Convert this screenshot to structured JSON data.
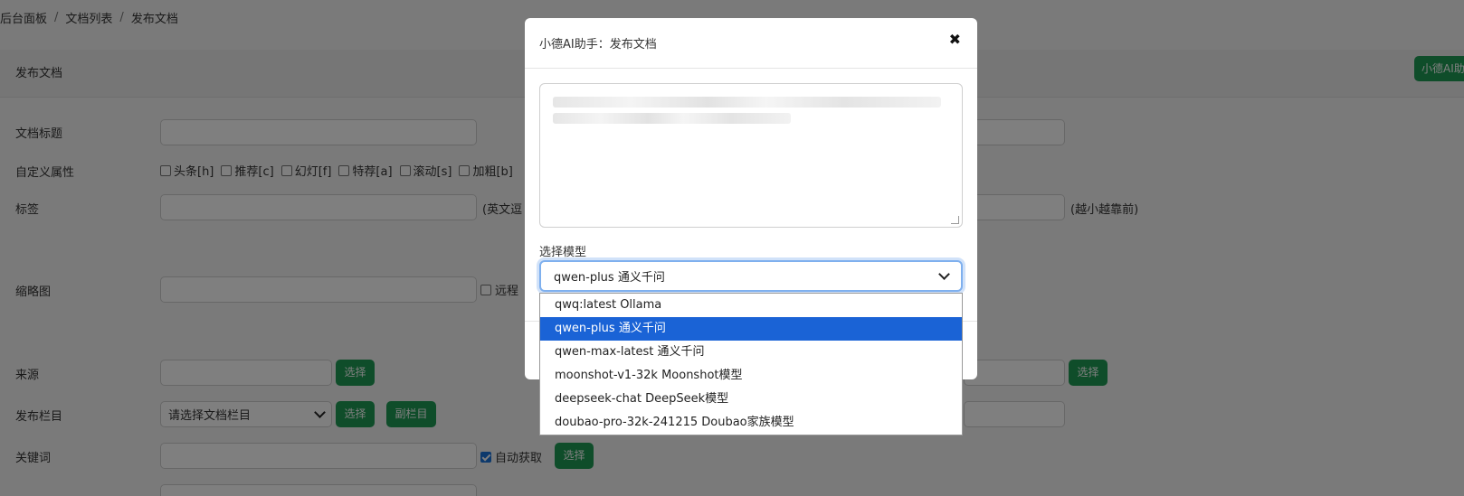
{
  "breadcrumb": {
    "items": [
      "后台面板",
      "文档列表",
      "发布文档"
    ],
    "separator": "/"
  },
  "form": {
    "header_title": "发布文档",
    "ai_button_label": "小德AI助",
    "labels": {
      "title": "文档标题",
      "attrs": "自定义属性",
      "tags": "标签",
      "thumb": "缩略图",
      "source": "来源",
      "column": "发布栏目",
      "keywords": "关键词"
    },
    "attrs": [
      "头条[h]",
      "推荐[c]",
      "幻灯[f]",
      "特荐[a]",
      "滚动[s]",
      "加粗[b]"
    ],
    "tags_hint": "(英文逗",
    "weight_hint": "(越小越靠前)",
    "thumb_remote": "远程",
    "select_btn": "选择",
    "sub_column_btn": "副栏目",
    "column_placeholder": "请选择文档栏目",
    "auto_fetch": "自动获取"
  },
  "modal": {
    "title": "小德AI助手：发布文档",
    "close": "✖",
    "model_label": "选择模型",
    "selected_model": "qwen-plus 通义千问",
    "options": [
      "qwq:latest Ollama",
      "qwen-plus 通义千问",
      "qwen-max-latest 通义千问",
      "moonshot-v1-32k Moonshot模型",
      "deepseek-chat DeepSeek模型",
      "doubao-pro-32k-241215 Doubao家族模型"
    ],
    "selected_index": 1
  },
  "colors": {
    "accent_green": "#1e9a55",
    "select_blue": "#1a63d6",
    "overlay": "rgba(0,0,0,0.5)"
  }
}
